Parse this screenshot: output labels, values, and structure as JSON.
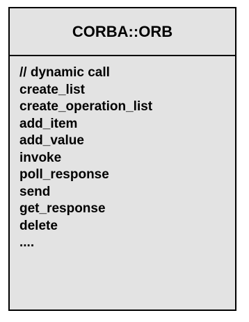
{
  "class_box": {
    "name": "CORBA::ORB",
    "members": [
      "// dynamic call",
      "create_list",
      "create_operation_list",
      "add_item",
      "add_value",
      "invoke",
      "poll_response",
      "send",
      "get_response",
      "delete",
      "...."
    ]
  },
  "colors": {
    "box_fill": "#e3e3e3",
    "border": "#000000",
    "text": "#000000"
  }
}
